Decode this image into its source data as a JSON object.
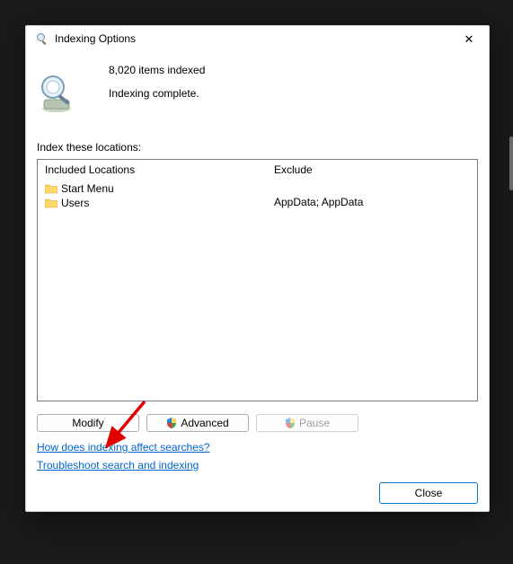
{
  "window": {
    "title": "Indexing Options"
  },
  "status": {
    "count_line": "8,020 items indexed",
    "state_line": "Indexing complete."
  },
  "section_label": "Index these locations:",
  "columns": {
    "included_header": "Included Locations",
    "exclude_header": "Exclude"
  },
  "locations": [
    {
      "name": "Start Menu",
      "exclude": ""
    },
    {
      "name": "Users",
      "exclude": "AppData; AppData"
    }
  ],
  "buttons": {
    "modify": "Modify",
    "advanced": "Advanced",
    "pause": "Pause",
    "close": "Close"
  },
  "links": {
    "how": "How does indexing affect searches?",
    "troubleshoot": "Troubleshoot search and indexing"
  }
}
